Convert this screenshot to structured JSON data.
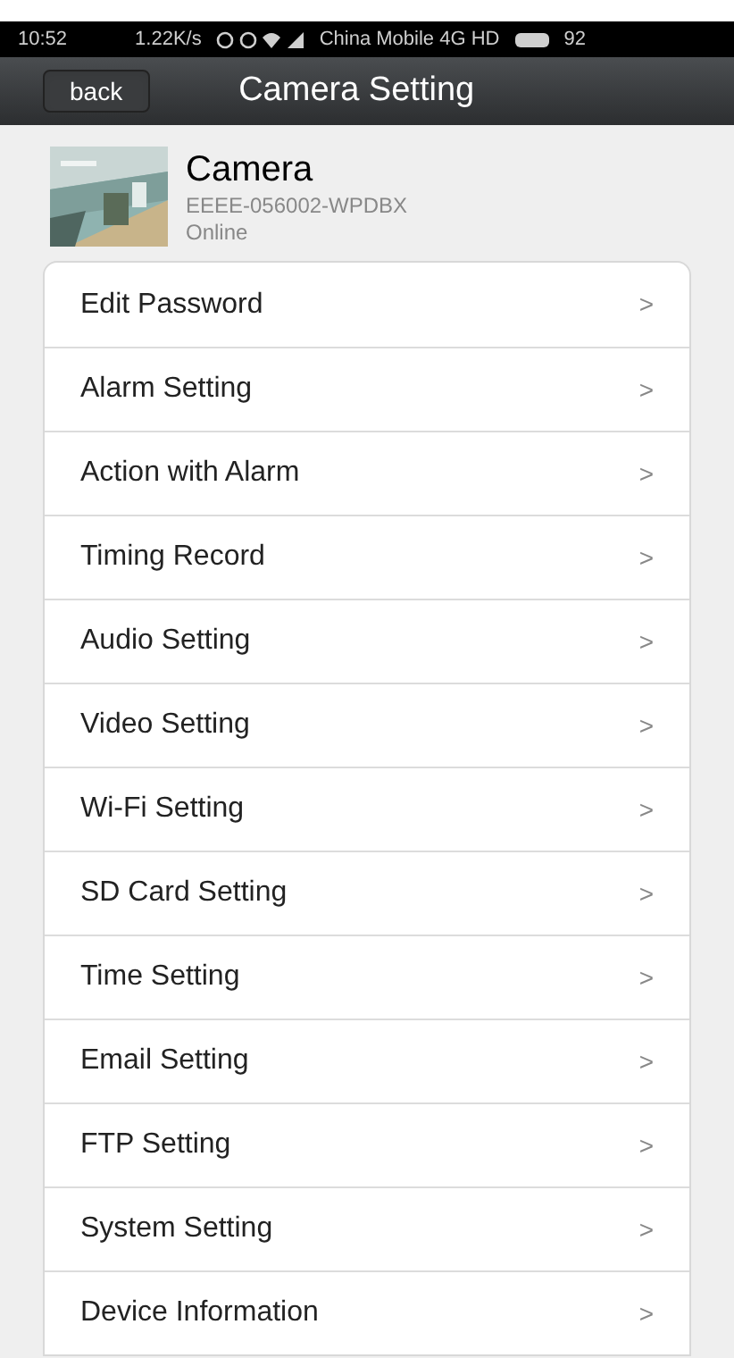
{
  "status_bar": {
    "time": "10:52",
    "speed": "1.22K/s",
    "carrier": "China Mobile 4G HD",
    "battery": "92"
  },
  "header": {
    "back": "back",
    "title": "Camera Setting"
  },
  "device": {
    "name": "Camera",
    "id": "EEEE-056002-WPDBX",
    "status": "Online"
  },
  "menu": [
    {
      "label": "Edit Password",
      "chevron": ">"
    },
    {
      "label": "Alarm Setting",
      "chevron": ">"
    },
    {
      "label": "Action with Alarm",
      "chevron": ">"
    },
    {
      "label": "Timing Record",
      "chevron": ">"
    },
    {
      "label": "Audio Setting",
      "chevron": ">"
    },
    {
      "label": "Video Setting",
      "chevron": ">"
    },
    {
      "label": "Wi-Fi Setting",
      "chevron": ">"
    },
    {
      "label": "SD Card Setting",
      "chevron": ">"
    },
    {
      "label": "Time Setting",
      "chevron": ">"
    },
    {
      "label": "Email Setting",
      "chevron": ">"
    },
    {
      "label": "FTP Setting",
      "chevron": ">"
    },
    {
      "label": "System Setting",
      "chevron": ">"
    },
    {
      "label": "Device Information",
      "chevron": ">"
    }
  ]
}
